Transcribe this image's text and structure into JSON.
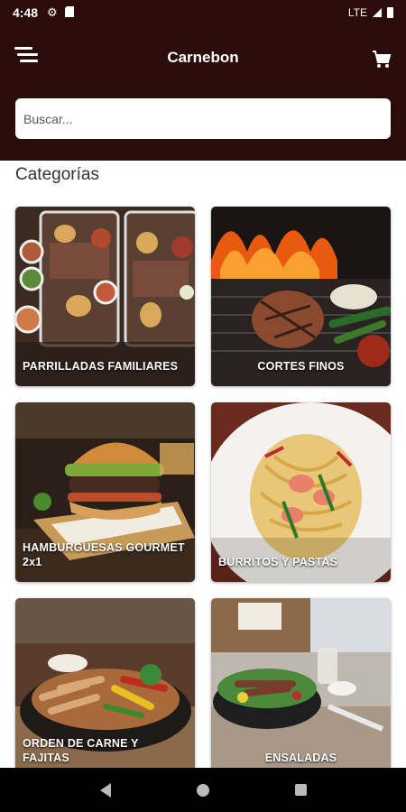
{
  "status_bar": {
    "time": "4:48",
    "network": "LTE"
  },
  "app": {
    "title": "Carnebon"
  },
  "search": {
    "placeholder": "Buscar..."
  },
  "section_title": "Categorías",
  "categories": [
    {
      "label": "PARRILLADAS FAMILIARES"
    },
    {
      "label": "CORTES FINOS"
    },
    {
      "label": "HAMBURGUESAS GOURMET 2x1"
    },
    {
      "label": "BURRITOS Y PASTAS"
    },
    {
      "label": "ORDEN DE CARNE Y FAJITAS"
    },
    {
      "label": "ENSALADAS"
    }
  ],
  "colors": {
    "brand": "#2b0c08",
    "background": "#ffffff"
  }
}
